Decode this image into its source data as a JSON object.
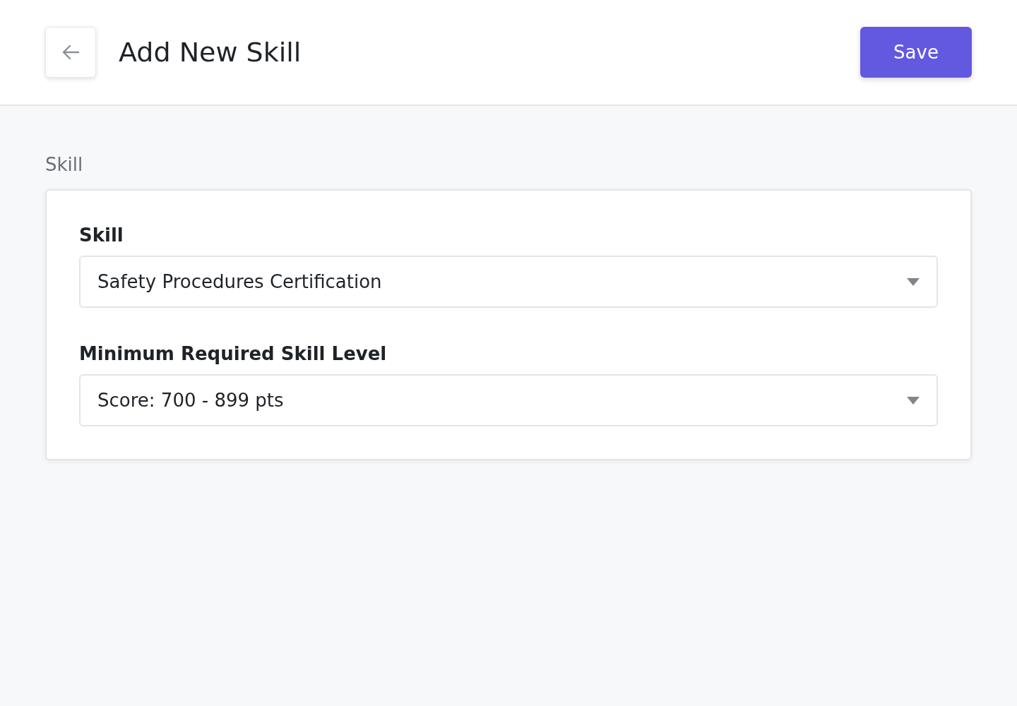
{
  "header": {
    "title": "Add New Skill",
    "save_button": "Save"
  },
  "section": {
    "title": "Skill",
    "fields": [
      {
        "label": "Skill",
        "value": "Safety Procedures Certification"
      },
      {
        "label": "Minimum Required Skill Level",
        "value": "Score: 700 - 899 pts"
      }
    ]
  }
}
